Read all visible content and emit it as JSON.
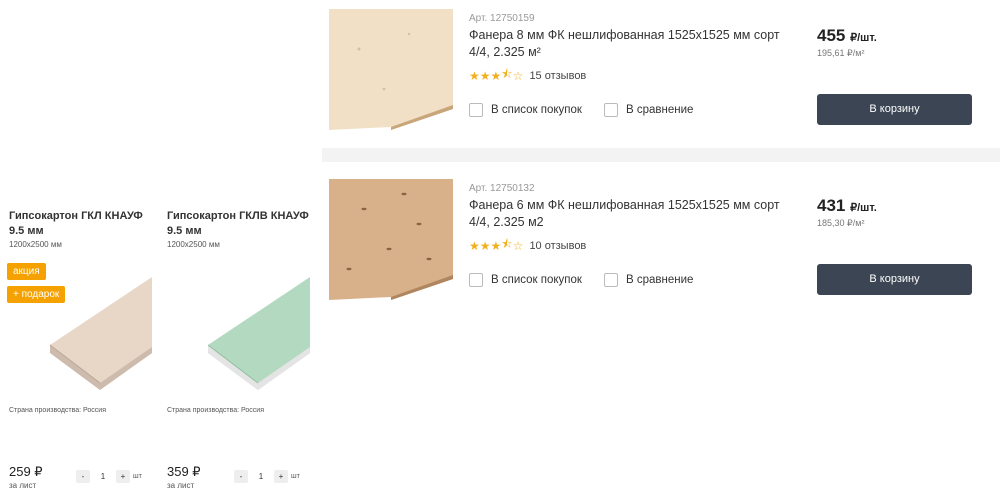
{
  "cards": [
    {
      "title": "Гипсокартон ГКЛ КНАУФ",
      "thickness": "9.5 мм",
      "size": "1200х2500 мм",
      "badges": [
        "акция",
        "+ подарок"
      ],
      "country": "Страна производства: Россия",
      "price": "259 ₽",
      "per_unit": "за лист",
      "qty_minus": "-",
      "qty": "1",
      "qty_plus": "+",
      "qty_unit": "шт",
      "color": "#e6d3c3"
    },
    {
      "title": "Гипсокартон ГКЛВ КНАУФ",
      "thickness": "9.5 мм",
      "size": "1200х2500 мм",
      "badges": [],
      "country": "Страна производства: Россия",
      "price": "359 ₽",
      "per_unit": "за лист",
      "qty_minus": "-",
      "qty": "1",
      "qty_plus": "+",
      "qty_unit": "шт",
      "color": "#a9d3b8"
    }
  ],
  "products": [
    {
      "article": "Арт. 12750159",
      "name": "Фанера 8 мм ФК нешлифованная 1525х1525 мм сорт 4/4, 2.325 м²",
      "rating": 3.5,
      "reviews": "15 отзывов",
      "shopping_list": "В список покупок",
      "compare": "В сравнение",
      "price": "455",
      "price_unit": "₽/шт.",
      "price_per_m2": "195,61 ₽/м²",
      "cart": "В корзину",
      "color": "#efdcc0"
    },
    {
      "article": "Арт. 12750132",
      "name": "Фанера 6 мм ФК нешлифованная 1525х1525 мм сорт 4/4, 2.325 м2",
      "rating": 3.5,
      "reviews": "10 отзывов",
      "shopping_list": "В список покупок",
      "compare": "В сравнение",
      "price": "431",
      "price_unit": "₽/шт.",
      "price_per_m2": "185,30 ₽/м²",
      "cart": "В корзину",
      "color": "#d9b28a"
    }
  ],
  "colors": {
    "accent_badge": "#f5a100",
    "cart_button": "#3b4553",
    "star": "#f2b01e"
  }
}
